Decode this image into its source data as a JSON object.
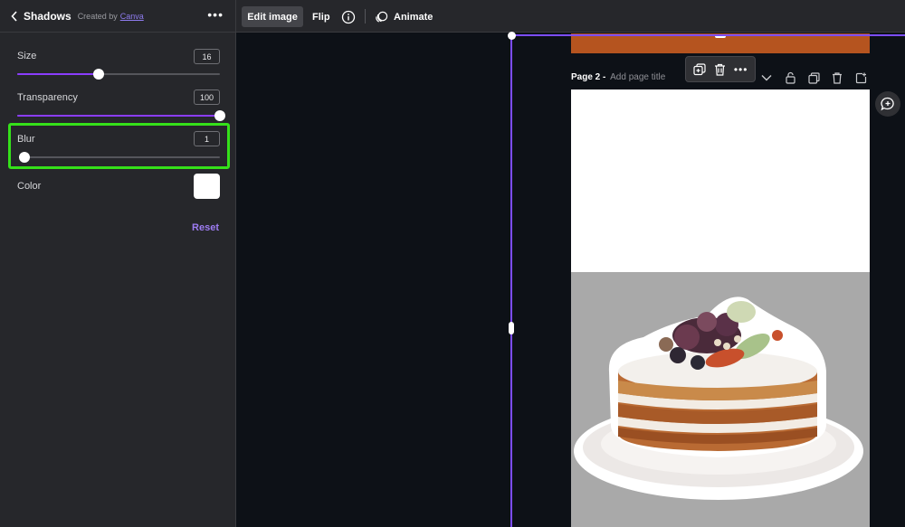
{
  "panel": {
    "title": "Shadows",
    "created_by": "Created by",
    "creator_link": "Canva",
    "size": {
      "label": "Size",
      "value": "16",
      "fraction": 0.4
    },
    "transparency": {
      "label": "Transparency",
      "value": "100",
      "fraction": 1.0
    },
    "blur": {
      "label": "Blur",
      "value": "1",
      "fraction": 0.01
    },
    "color": {
      "label": "Color",
      "swatch": "#ffffff"
    },
    "reset_label": "Reset"
  },
  "toolbar": {
    "edit_image": "Edit image",
    "flip": "Flip",
    "animate": "Animate"
  },
  "page": {
    "label": "Page 2 -",
    "title_placeholder": "Add page title"
  },
  "colors": {
    "accent": "#8b3dff",
    "highlight": "#35e11a",
    "page1_strip": "#b5541f"
  },
  "icons": [
    "back-icon",
    "more-icon",
    "info-icon",
    "animate-icon",
    "duplicate-icon",
    "trash-icon",
    "chevron-down-icon",
    "lock-icon",
    "copy-page-icon",
    "add-page-icon",
    "comment-icon"
  ]
}
